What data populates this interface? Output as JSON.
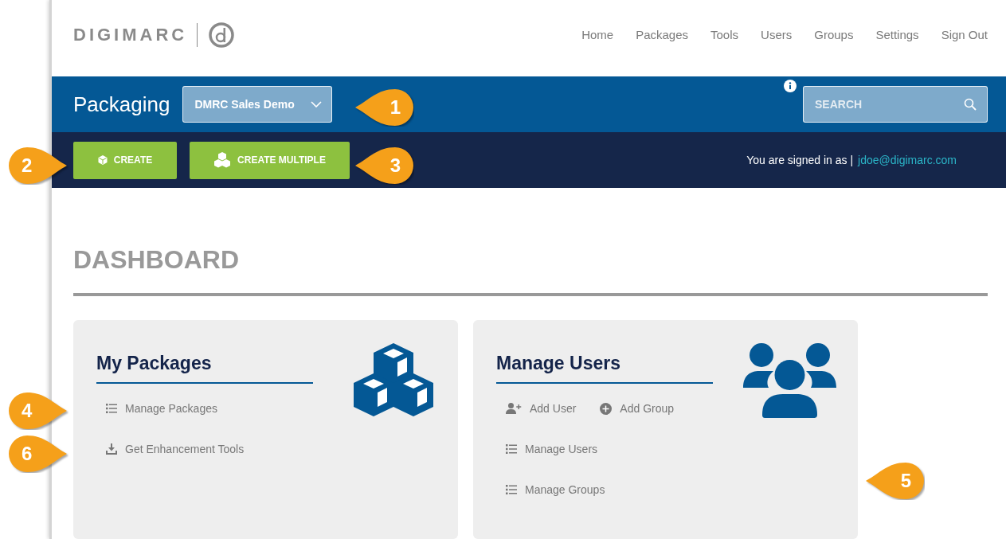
{
  "logo": {
    "wordmark": "DIGIMARC"
  },
  "nav": [
    {
      "label": "Home"
    },
    {
      "label": "Packages"
    },
    {
      "label": "Tools"
    },
    {
      "label": "Users"
    },
    {
      "label": "Groups"
    },
    {
      "label": "Settings"
    },
    {
      "label": "Sign Out"
    }
  ],
  "app_bar": {
    "title": "Packaging",
    "account_dropdown": {
      "value": "DMRC Sales Demo"
    },
    "search": {
      "placeholder": "SEARCH"
    }
  },
  "action_bar": {
    "buttons": [
      {
        "label": "CREATE",
        "kind": "single"
      },
      {
        "label": "CREATE MULTIPLE",
        "kind": "multiple"
      }
    ],
    "signed_in_label": "You are signed in as |",
    "user_email": "jdoe@digimarc.com"
  },
  "dashboard": {
    "title": "DASHBOARD",
    "cards": [
      {
        "title": "My Packages",
        "kind": "packages",
        "link_rows": [
          [
            {
              "label": "Manage Packages",
              "kind": "list"
            }
          ],
          [
            {
              "label": "Get Enhancement Tools",
              "kind": "download"
            }
          ]
        ]
      },
      {
        "title": "Manage Users",
        "kind": "users",
        "link_rows": [
          [
            {
              "label": "Add User",
              "kind": "add-user"
            },
            {
              "label": "Add Group",
              "kind": "add"
            }
          ],
          [
            {
              "label": "Manage Users",
              "kind": "list"
            }
          ],
          [
            {
              "label": "Manage Groups",
              "kind": "list"
            }
          ]
        ]
      }
    ]
  },
  "callouts": [
    {
      "number": "1",
      "kind": "left"
    },
    {
      "number": "2",
      "kind": "right"
    },
    {
      "number": "3",
      "kind": "left"
    },
    {
      "number": "4",
      "kind": "right"
    },
    {
      "number": "6",
      "kind": "right"
    },
    {
      "number": "5",
      "kind": "left"
    }
  ]
}
